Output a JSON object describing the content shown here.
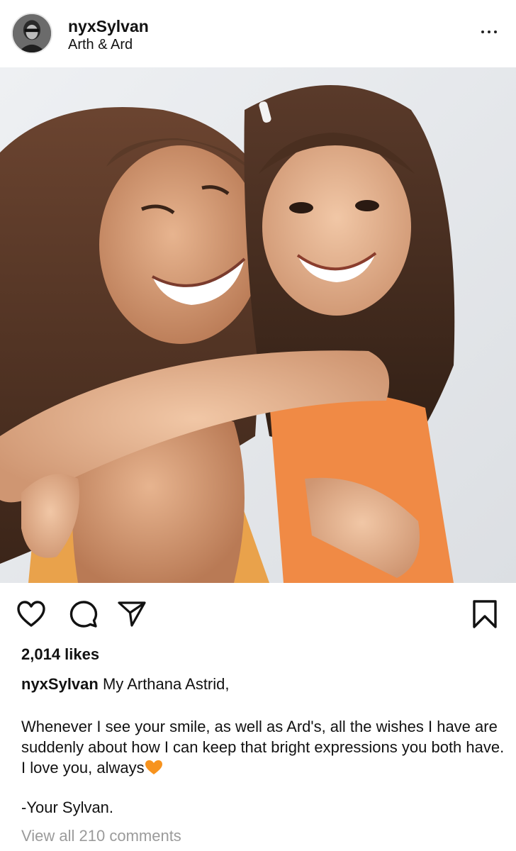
{
  "post": {
    "username": "nyxSylvan",
    "location": "Arth & Ard",
    "likes": "2,014 likes",
    "caption": {
      "username": "nyxSylvan",
      "first_line": "My Arthana Astrid,",
      "body": "Whenever I see your smile, as well as Ard's, all the wishes I have are suddenly about how I can keep that bright expressions you both have. I love you, always",
      "signoff": "-Your Sylvan."
    },
    "comments_link": "View all 210 comments"
  },
  "icons": {
    "more": "more-options-icon",
    "like": "heart-outline-icon",
    "comment": "comment-bubble-icon",
    "share": "paper-plane-icon",
    "save": "bookmark-icon",
    "emoji": "orange-heart-emoji"
  },
  "colors": {
    "text": "#121212",
    "muted": "#9b9b9b",
    "heart_emoji": "#f7931e"
  }
}
